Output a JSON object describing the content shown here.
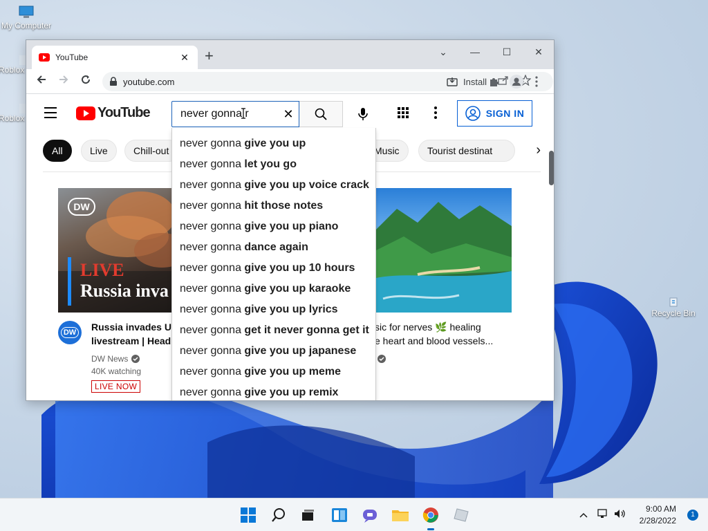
{
  "desktop": {
    "icons": [
      {
        "label": "My Computer"
      },
      {
        "label": "Roblox"
      },
      {
        "label": "Roblox"
      },
      {
        "label": "Recycle Bin"
      }
    ]
  },
  "browser": {
    "tab": {
      "title": "YouTube",
      "close": "✕"
    },
    "new_tab": "+",
    "window_controls": {
      "minimize": "—",
      "maximize": "☐",
      "close": "✕",
      "dropdown": "⌄"
    },
    "url": "youtube.com",
    "install_label": "Install"
  },
  "youtube": {
    "logo_text": "YouTube",
    "search": {
      "query": "never gonna r",
      "placeholder": "Search"
    },
    "sign_in": "SIGN IN",
    "chips": [
      "All",
      "Live",
      "Chill-out",
      "Music",
      "Tourist destinat"
    ],
    "suggestions": [
      {
        "prefix": "never gonna ",
        "completion": "give you up"
      },
      {
        "prefix": "never gonna ",
        "completion": "let you go"
      },
      {
        "prefix": "never gonna ",
        "completion": "give you up voice crack"
      },
      {
        "prefix": "never gonna ",
        "completion": "hit those notes"
      },
      {
        "prefix": "never gonna ",
        "completion": "give you up piano"
      },
      {
        "prefix": "never gonna ",
        "completion": "dance again"
      },
      {
        "prefix": "never gonna ",
        "completion": "give you up 10 hours"
      },
      {
        "prefix": "never gonna ",
        "completion": "give you up karaoke"
      },
      {
        "prefix": "never gonna ",
        "completion": "give you up lyrics"
      },
      {
        "prefix": "never gonna ",
        "completion": "get it never gonna get it"
      },
      {
        "prefix": "never gonna ",
        "completion": "give you up japanese"
      },
      {
        "prefix": "never gonna ",
        "completion": "give you up meme"
      },
      {
        "prefix": "never gonna ",
        "completion": "give you up remix"
      }
    ],
    "videos": [
      {
        "thumb_live": "LIVE",
        "thumb_headline": "Russia inva",
        "thumb_brand": "DW",
        "title_line1": "Russia invades Ukr",
        "title_line2": "livestream | Headli",
        "channel": "DW News",
        "viewers": "40K watching",
        "badge": "LIVE NOW",
        "avatar": "DW"
      },
      {
        "title_line1": "sic for nerves 🌿 healing",
        "title_line2": "e heart and blood vessels..."
      }
    ]
  },
  "taskbar": {
    "time": "9:00 AM",
    "date": "2/28/2022",
    "notifications": "1"
  },
  "colors": {
    "youtube_red": "#ff0000",
    "signin_blue": "#065fd4",
    "search_border": "#1c62b9",
    "live_red": "#cc0000"
  }
}
